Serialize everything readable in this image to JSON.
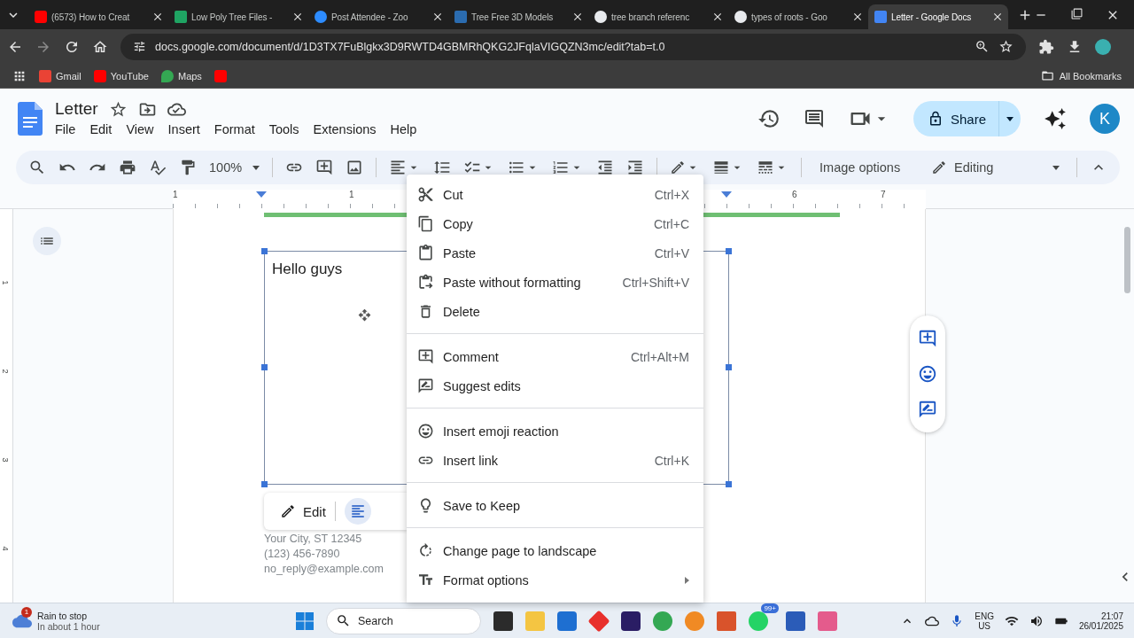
{
  "browser": {
    "tabs": [
      {
        "kind": "youtube",
        "title": "(6573) How to Creat",
        "selected": false
      },
      {
        "kind": "drive",
        "title": "Low Poly Tree Files -",
        "selected": false
      },
      {
        "kind": "zoom",
        "title": "Post Attendee - Zoo",
        "selected": false
      },
      {
        "kind": "model",
        "title": "Tree Free 3D Models",
        "selected": false
      },
      {
        "kind": "google",
        "title": "tree branch referenc",
        "selected": false
      },
      {
        "kind": "google",
        "title": "types of roots - Goo",
        "selected": false
      },
      {
        "kind": "docs",
        "title": "Letter - Google Docs",
        "selected": true
      }
    ],
    "address": "docs.google.com/document/d/1D3TX7FuBlgkx3D9RWTD4GBMRhQKG2JFqlaVIGQZN3mc/edit?tab=t.0",
    "bookmarks": [
      {
        "kind": "gmail",
        "label": "Gmail"
      },
      {
        "kind": "youtube",
        "label": "YouTube"
      },
      {
        "kind": "maps",
        "label": "Maps"
      },
      {
        "kind": "youtube"
      }
    ],
    "all_bookmarks": "All Bookmarks"
  },
  "docs": {
    "title": "Letter",
    "menus": [
      "File",
      "Edit",
      "View",
      "Insert",
      "Format",
      "Tools",
      "Extensions",
      "Help"
    ],
    "share": "Share",
    "avatar": "K",
    "zoom": "100%",
    "image_options": "Image options",
    "mode": "Editing",
    "ruler": [
      "1",
      "1",
      "6",
      "7"
    ],
    "vertical_ruler": [
      "1",
      "2",
      "3",
      "4"
    ],
    "textbox": "Hello guys",
    "edit_bar": {
      "edit": "Edit"
    },
    "address_lines": [
      "Your City, ST 12345",
      "(123) 456-7890",
      "no_reply@example.com"
    ]
  },
  "context_menu": [
    [
      {
        "label": "Cut",
        "shortcut": "Ctrl+X"
      },
      {
        "label": "Copy",
        "shortcut": "Ctrl+C"
      },
      {
        "label": "Paste",
        "shortcut": "Ctrl+V"
      },
      {
        "label": "Paste without formatting",
        "shortcut": "Ctrl+Shift+V"
      },
      {
        "label": "Delete"
      }
    ],
    [
      {
        "label": "Comment",
        "shortcut": "Ctrl+Alt+M"
      },
      {
        "label": "Suggest edits"
      }
    ],
    [
      {
        "label": "Insert emoji reaction"
      },
      {
        "label": "Insert link",
        "shortcut": "Ctrl+K"
      }
    ],
    [
      {
        "label": "Save to Keep"
      }
    ],
    [
      {
        "label": "Change page to landscape"
      },
      {
        "label": "Format options",
        "submenu": true
      }
    ]
  ],
  "taskbar": {
    "weather": {
      "badge": "1",
      "title": "Rain to stop",
      "subtitle": "In about 1 hour"
    },
    "search": "Search",
    "whatsapp_badge": "99+",
    "language": "ENG",
    "region": "US",
    "time": "21:07",
    "date": "26/01/2025"
  }
}
